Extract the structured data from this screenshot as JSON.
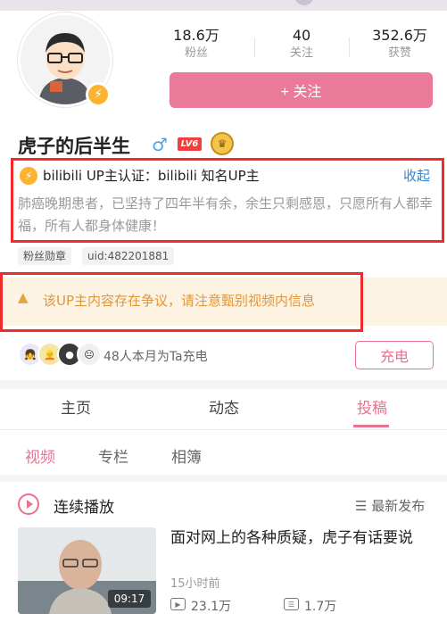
{
  "profile": {
    "stats": [
      {
        "value": "18.6万",
        "label": "粉丝"
      },
      {
        "value": "40",
        "label": "关注"
      },
      {
        "value": "352.6万",
        "label": "获赞"
      }
    ],
    "follow_label": "+ 关注",
    "name": "虎子的后半生",
    "gender_symbol": "♂",
    "level_badge": "LV6"
  },
  "verification": {
    "text": "bilibili  UP主认证：bilibili  知名UP主",
    "collapse_label": "收起",
    "bio": "肺癌晚期患者，已坚持了四年半有余，余生只剩感恩，只愿所有人都幸福，所有人都身体健康！"
  },
  "tags": [
    "粉丝勋章",
    "uid:482201881"
  ],
  "warning": {
    "text": "该UP主内容存在争议，请注意甄别视频内信息"
  },
  "charge": {
    "text": "48人本月为Ta充电",
    "button_label": "充电"
  },
  "tabs": [
    "主页",
    "动态",
    "投稿"
  ],
  "subtabs": [
    "视频",
    "专栏",
    "相簿"
  ],
  "playlist": {
    "label": "连续播放",
    "sort_label": "☰ 最新发布"
  },
  "video": {
    "title": "面对网上的各种质疑，虎子有话要说",
    "time": "15小时前",
    "duration": "09:17",
    "plays": "23.1万",
    "danmaku": "1.7万"
  },
  "colors": {
    "accent_pink": "#e8728f",
    "follow_pink": "#ea7a99",
    "link_blue": "#2f86d4",
    "warning_orange": "#e0963a",
    "highlight_red": "#ef2b2b",
    "badge_yellow": "#fbb330"
  }
}
